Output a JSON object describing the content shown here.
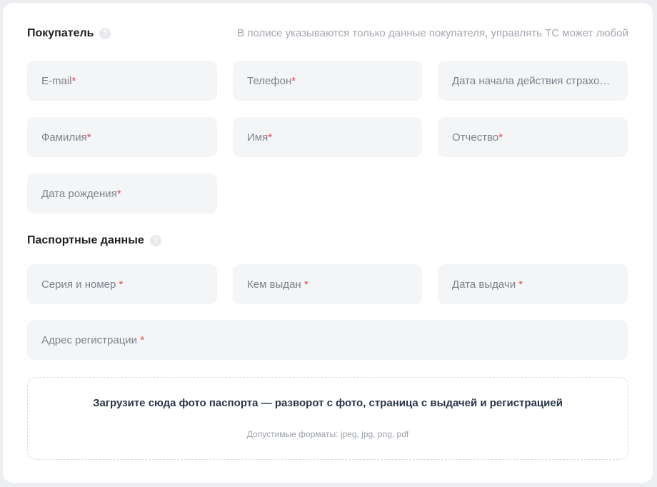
{
  "buyer": {
    "title": "Покупатель",
    "hint": "В полисе указываются только данные покупателя, управлять ТС может любой",
    "fields": {
      "email": {
        "label": "E-mail",
        "required_mark": "*"
      },
      "phone": {
        "label": "Телефон",
        "required_mark": "*"
      },
      "start_date": {
        "label": "Дата начала действия страховки",
        "required_mark": "*"
      },
      "last_name": {
        "label": "Фамилия",
        "required_mark": "*"
      },
      "first_name": {
        "label": "Имя",
        "required_mark": "*"
      },
      "middle_name": {
        "label": "Отчество",
        "required_mark": "*"
      },
      "birth_date": {
        "label": "Дата рождения",
        "required_mark": "*"
      }
    }
  },
  "passport": {
    "title": "Паспортные данные",
    "fields": {
      "series_number": {
        "label": "Серия и номер ",
        "required_mark": "*"
      },
      "issued_by": {
        "label": "Кем выдан ",
        "required_mark": "*"
      },
      "issue_date": {
        "label": "Дата выдачи ",
        "required_mark": "*"
      },
      "registration_address": {
        "label": "Адрес регистрации ",
        "required_mark": "*"
      }
    }
  },
  "upload": {
    "title": "Загрузите сюда фото паспорта — разворот с фото, страница с выдачей и регистрацией",
    "formats": "Допустимые форматы: jpeg, jpg, png, pdf"
  },
  "icons": {
    "help": "question-circle-icon"
  },
  "colors": {
    "required": "#e04a4a",
    "field_bg": "#f4f5f7",
    "hint": "#a3a8b0"
  }
}
